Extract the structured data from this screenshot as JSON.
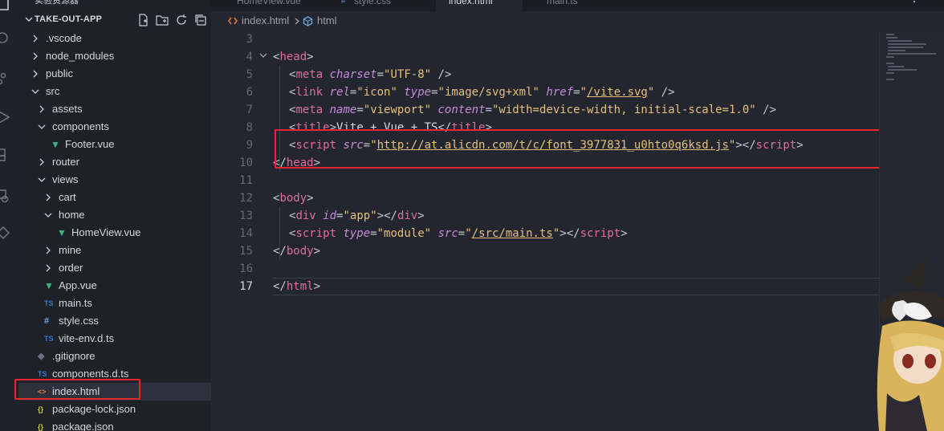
{
  "explorer": {
    "header_partial": "实验资源器",
    "project": "TAKE-OUT-APP",
    "tool_icons": [
      "new-file-icon",
      "new-folder-icon",
      "refresh-icon",
      "collapse-all-icon"
    ],
    "items": [
      {
        "label": ".vscode",
        "kind": "folder",
        "open": false
      },
      {
        "label": "node_modules",
        "kind": "folder",
        "open": false
      },
      {
        "label": "public",
        "kind": "folder",
        "open": false
      },
      {
        "label": "src",
        "kind": "folder",
        "open": true
      },
      {
        "label": "assets",
        "kind": "folder",
        "open": false
      },
      {
        "label": "components",
        "kind": "folder",
        "open": true
      },
      {
        "label": "Footer.vue",
        "kind": "vue"
      },
      {
        "label": "router",
        "kind": "folder",
        "open": false
      },
      {
        "label": "views",
        "kind": "folder",
        "open": true
      },
      {
        "label": "cart",
        "kind": "folder",
        "open": false
      },
      {
        "label": "home",
        "kind": "folder",
        "open": true
      },
      {
        "label": "HomeView.vue",
        "kind": "vue"
      },
      {
        "label": "mine",
        "kind": "folder",
        "open": false
      },
      {
        "label": "order",
        "kind": "folder",
        "open": false
      },
      {
        "label": "App.vue",
        "kind": "vue"
      },
      {
        "label": "main.ts",
        "kind": "ts"
      },
      {
        "label": "style.css",
        "kind": "css"
      },
      {
        "label": "vite-env.d.ts",
        "kind": "ts"
      },
      {
        "label": ".gitignore",
        "kind": "git"
      },
      {
        "label": "components.d.ts",
        "kind": "ts"
      },
      {
        "label": "index.html",
        "kind": "html",
        "selected": true
      },
      {
        "label": "package-lock.json",
        "kind": "json"
      },
      {
        "label": "package.json",
        "kind": "json"
      }
    ]
  },
  "tabs": [
    {
      "label": "HomeView.vue",
      "active": false
    },
    {
      "label": "style.css",
      "active": false
    },
    {
      "label": "index.html",
      "active": true
    },
    {
      "label": "main.ts",
      "active": false
    }
  ],
  "breadcrumb": {
    "file": "index.html",
    "symbol": "html"
  },
  "code": {
    "lines": [
      "3",
      "4",
      "5",
      "6",
      "7",
      "8",
      "9",
      "10",
      "11",
      "12",
      "13",
      "14",
      "15",
      "16",
      "17"
    ],
    "meta_charset": "UTF-8",
    "link_rel": "icon",
    "link_type": "image/svg+xml",
    "link_href": "/vite.svg",
    "meta_name": "viewport",
    "meta_content": "width=device-width, initial-scale=1.0",
    "title_text": "Vite + Vue + TS",
    "script_src": "http://at.alicdn.com/t/c/font_3977831_u0hto0q6ksd.js",
    "div_id": "app",
    "script2_type": "module",
    "script2_src": "/src/main.ts"
  },
  "colors": {
    "highlight": "#e8262b",
    "vue": "#41b883",
    "ts": "#3178c6",
    "html": "#e37933",
    "json": "#cbcb41"
  }
}
